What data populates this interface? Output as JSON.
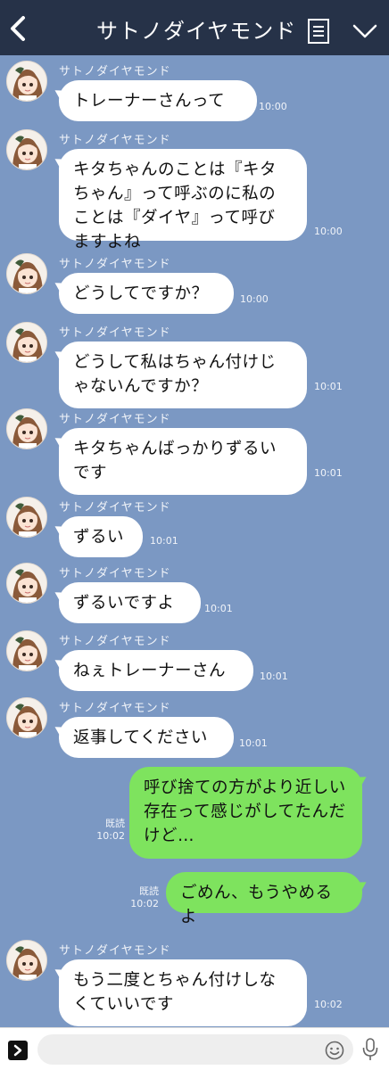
{
  "header": {
    "title": "サトノダイヤモンド",
    "back_icon": "chevron-left-icon",
    "menu_icon": "notes-icon",
    "dropdown_icon": "chevron-down-icon"
  },
  "sender_name": "サトノダイヤモンド",
  "messages": [
    {
      "side": "in",
      "text": "トレーナーさんって",
      "time": "10:00"
    },
    {
      "side": "in",
      "text": "キタちゃんのことは『キタ\nちゃん』って呼ぶのに私の\nことは『ダイヤ』って呼び\nますよね",
      "time": "10:00"
    },
    {
      "side": "in",
      "text": "どうしてですか？",
      "time": "10:00"
    },
    {
      "side": "in",
      "text": "どうして私はちゃん付けじ\nゃないんですか？",
      "time": "10:01"
    },
    {
      "side": "in",
      "text": "キタちゃんばっかりずるい\nです",
      "time": "10:01"
    },
    {
      "side": "in",
      "text": "ずるい",
      "time": "10:01"
    },
    {
      "side": "in",
      "text": "ずるいですよ",
      "time": "10:01"
    },
    {
      "side": "in",
      "text": "ねぇトレーナーさん",
      "time": "10:01"
    },
    {
      "side": "in",
      "text": "返事してください",
      "time": "10:01"
    },
    {
      "side": "out",
      "text": "呼び捨ての方がより近しい\n存在って感じがしてたんだ\nけど…",
      "read": "既読",
      "time": "10:02"
    },
    {
      "side": "out",
      "text": "ごめん、もうやめるよ",
      "read": "既読",
      "time": "10:02"
    },
    {
      "side": "in",
      "text": "もう二度とちゃん付けしな\nくていいです",
      "time": "10:02"
    }
  ],
  "footer": {
    "expand_icon": "expand-arrow-icon",
    "input_value": "",
    "input_placeholder": "",
    "emoji_icon": "smiley-icon",
    "mic_icon": "microphone-icon"
  },
  "colors": {
    "background": "#7b98c3",
    "header": "#263248",
    "incoming_bubble": "#ffffff",
    "outgoing_bubble": "#7ee35e"
  }
}
